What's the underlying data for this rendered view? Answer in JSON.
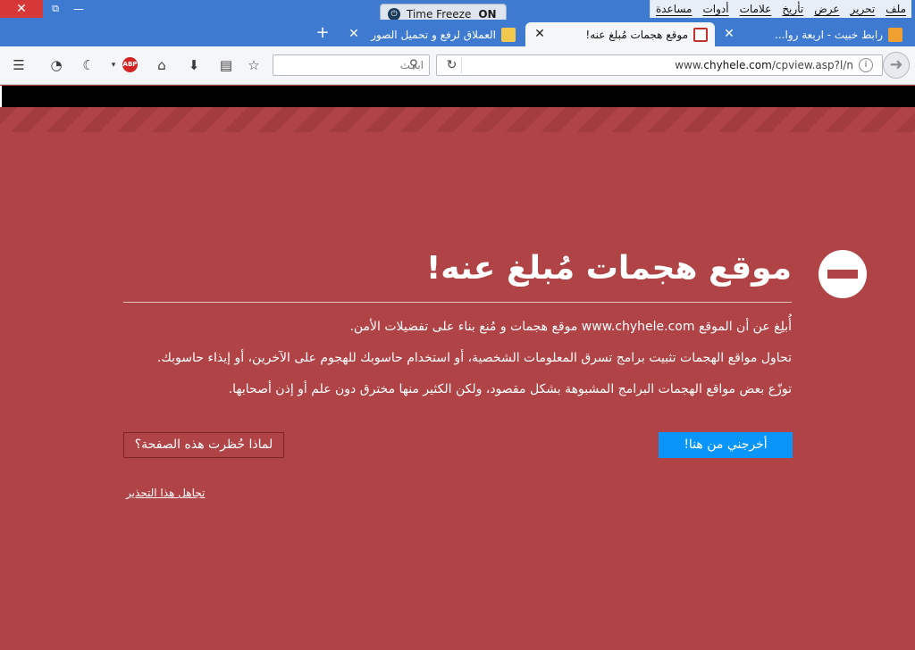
{
  "window": {
    "close_glyph": "✕",
    "restore_glyph": "⧉",
    "minimize_glyph": "—"
  },
  "menubar": {
    "items": [
      "ملف",
      "تحرير",
      "عرض",
      "تأريخ",
      "علامات",
      "أدوات",
      "مساعدة"
    ]
  },
  "time_freeze": {
    "label": "Time Freeze",
    "state": "ON"
  },
  "tabs": [
    {
      "title": "رابط خبيث - اربعة روا...",
      "active": false
    },
    {
      "title": "موقع هجمات مُبلغ عنه!",
      "active": true
    },
    {
      "title": "العملاق لرفع و تحميل الصور",
      "active": false
    }
  ],
  "new_tab_glyph": "+",
  "toolbar": {
    "search_placeholder": "ابحث",
    "url_prefix": "www.",
    "url_domain": "chyhele.com",
    "url_suffix": "/cpview.asp?l/n",
    "icons": [
      "menu-icon",
      "extension-icon",
      "night-mode-icon",
      "abp-icon",
      "home-icon",
      "download-icon",
      "reading-list-icon",
      "bookmark-star-icon",
      "reload-icon",
      "info-icon",
      "back-arrow-icon"
    ],
    "abp_label": "ABP"
  },
  "error_page": {
    "title": "موقع هجمات مُبلغ عنه!",
    "paragraph_1": "أُبلِغ عن أن الموقع www.chyhele.com موقع هجمات و مُنع بناء على تفضيلات الأمن.",
    "paragraph_2": "تحاول مواقع الهجمات تثبيت برامج تسرق المعلومات الشخصية، أو استخدام حاسوبك للهجوم على الآخرين، أو إيذاء حاسوبك.",
    "paragraph_3": "توزّع بعض مواقع الهجمات البرامج المشبوهة بشكل مقصود، ولكن الكثير منها مخترق دون علم أو إذن أصحابها.",
    "get_me_out_label": "أخرجني من هنا!",
    "why_blocked_label": "لماذا حُظرت هذه الصفحة؟",
    "ignore_label": "تجاهل هذا التحذير"
  },
  "colors": {
    "page_bg": "#b04345",
    "primary_button": "#0996f8",
    "titlebar": "#3e7bd0"
  }
}
